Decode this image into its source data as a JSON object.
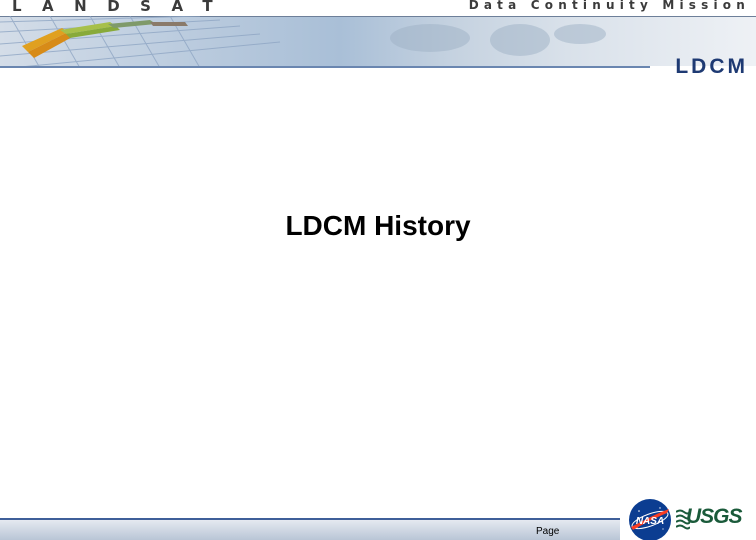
{
  "header": {
    "landsat_text": "LANDSAT",
    "mission_text": "Data Continuity Mission",
    "ldcm_logo_text": "LDCM"
  },
  "slide": {
    "title": "LDCM History"
  },
  "footer": {
    "page_label": "Page",
    "nasa_text": "NASA",
    "usgs_text": "USGS"
  },
  "colors": {
    "header_text": "#3b3b3b",
    "ldcm_blue": "#1e3a73",
    "footer_line": "#3f5f99",
    "usgs_green": "#1a5a3a",
    "nasa_blue": "#0b3d91",
    "nasa_red": "#fc3d21"
  }
}
